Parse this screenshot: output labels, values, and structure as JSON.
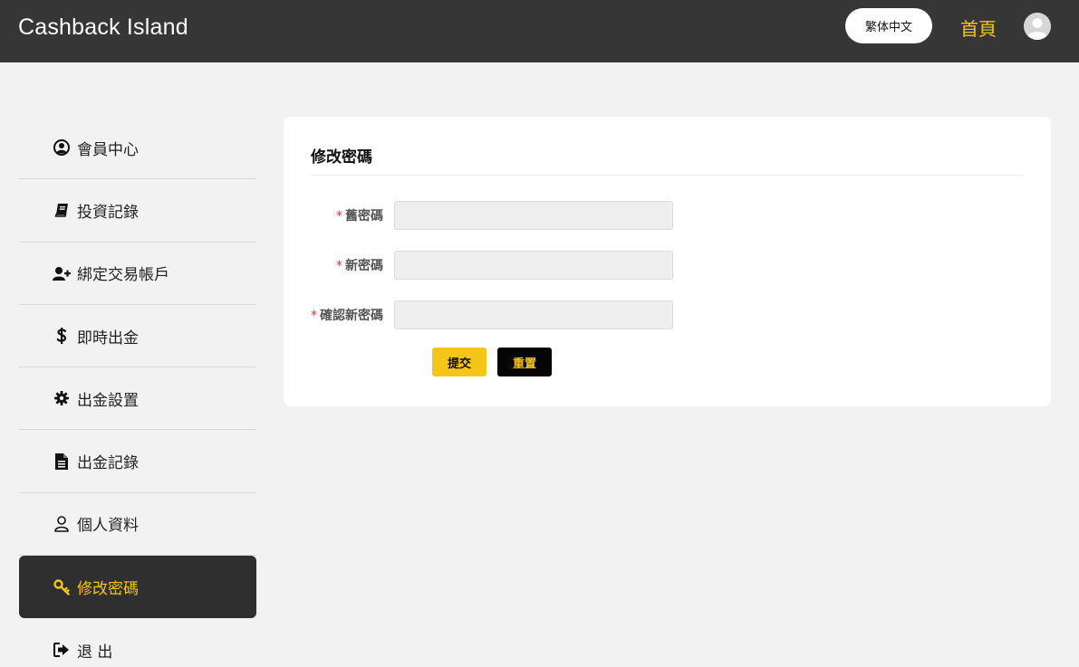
{
  "header": {
    "brand": "Cashback Island",
    "language": "繁体中文",
    "home": "首頁"
  },
  "sidebar": {
    "items": [
      {
        "label": "會員中心",
        "icon": "user-circle-icon"
      },
      {
        "label": "投資記錄",
        "icon": "book-icon"
      },
      {
        "label": "綁定交易帳戶",
        "icon": "user-plus-icon"
      },
      {
        "label": "即時出金",
        "icon": "dollar-icon"
      },
      {
        "label": "出金設置",
        "icon": "gear-icon"
      },
      {
        "label": "出金記錄",
        "icon": "document-icon"
      },
      {
        "label": "個人資料",
        "icon": "user-outline-icon"
      },
      {
        "label": "修改密碼",
        "icon": "key-icon",
        "active": true
      },
      {
        "label": "退 出",
        "icon": "sign-out-icon"
      }
    ]
  },
  "form": {
    "title": "修改密碼",
    "fields": [
      {
        "label": "舊密碼",
        "value": ""
      },
      {
        "label": "新密碼",
        "value": ""
      },
      {
        "label": "確認新密碼",
        "value": ""
      }
    ],
    "required_mark": "*",
    "submit_label": "提交",
    "reset_label": "重置"
  },
  "colors": {
    "header_bg": "#363636",
    "accent": "#f5c518",
    "page_bg": "#f2f2f2",
    "active_bg": "#2f2f2f"
  }
}
